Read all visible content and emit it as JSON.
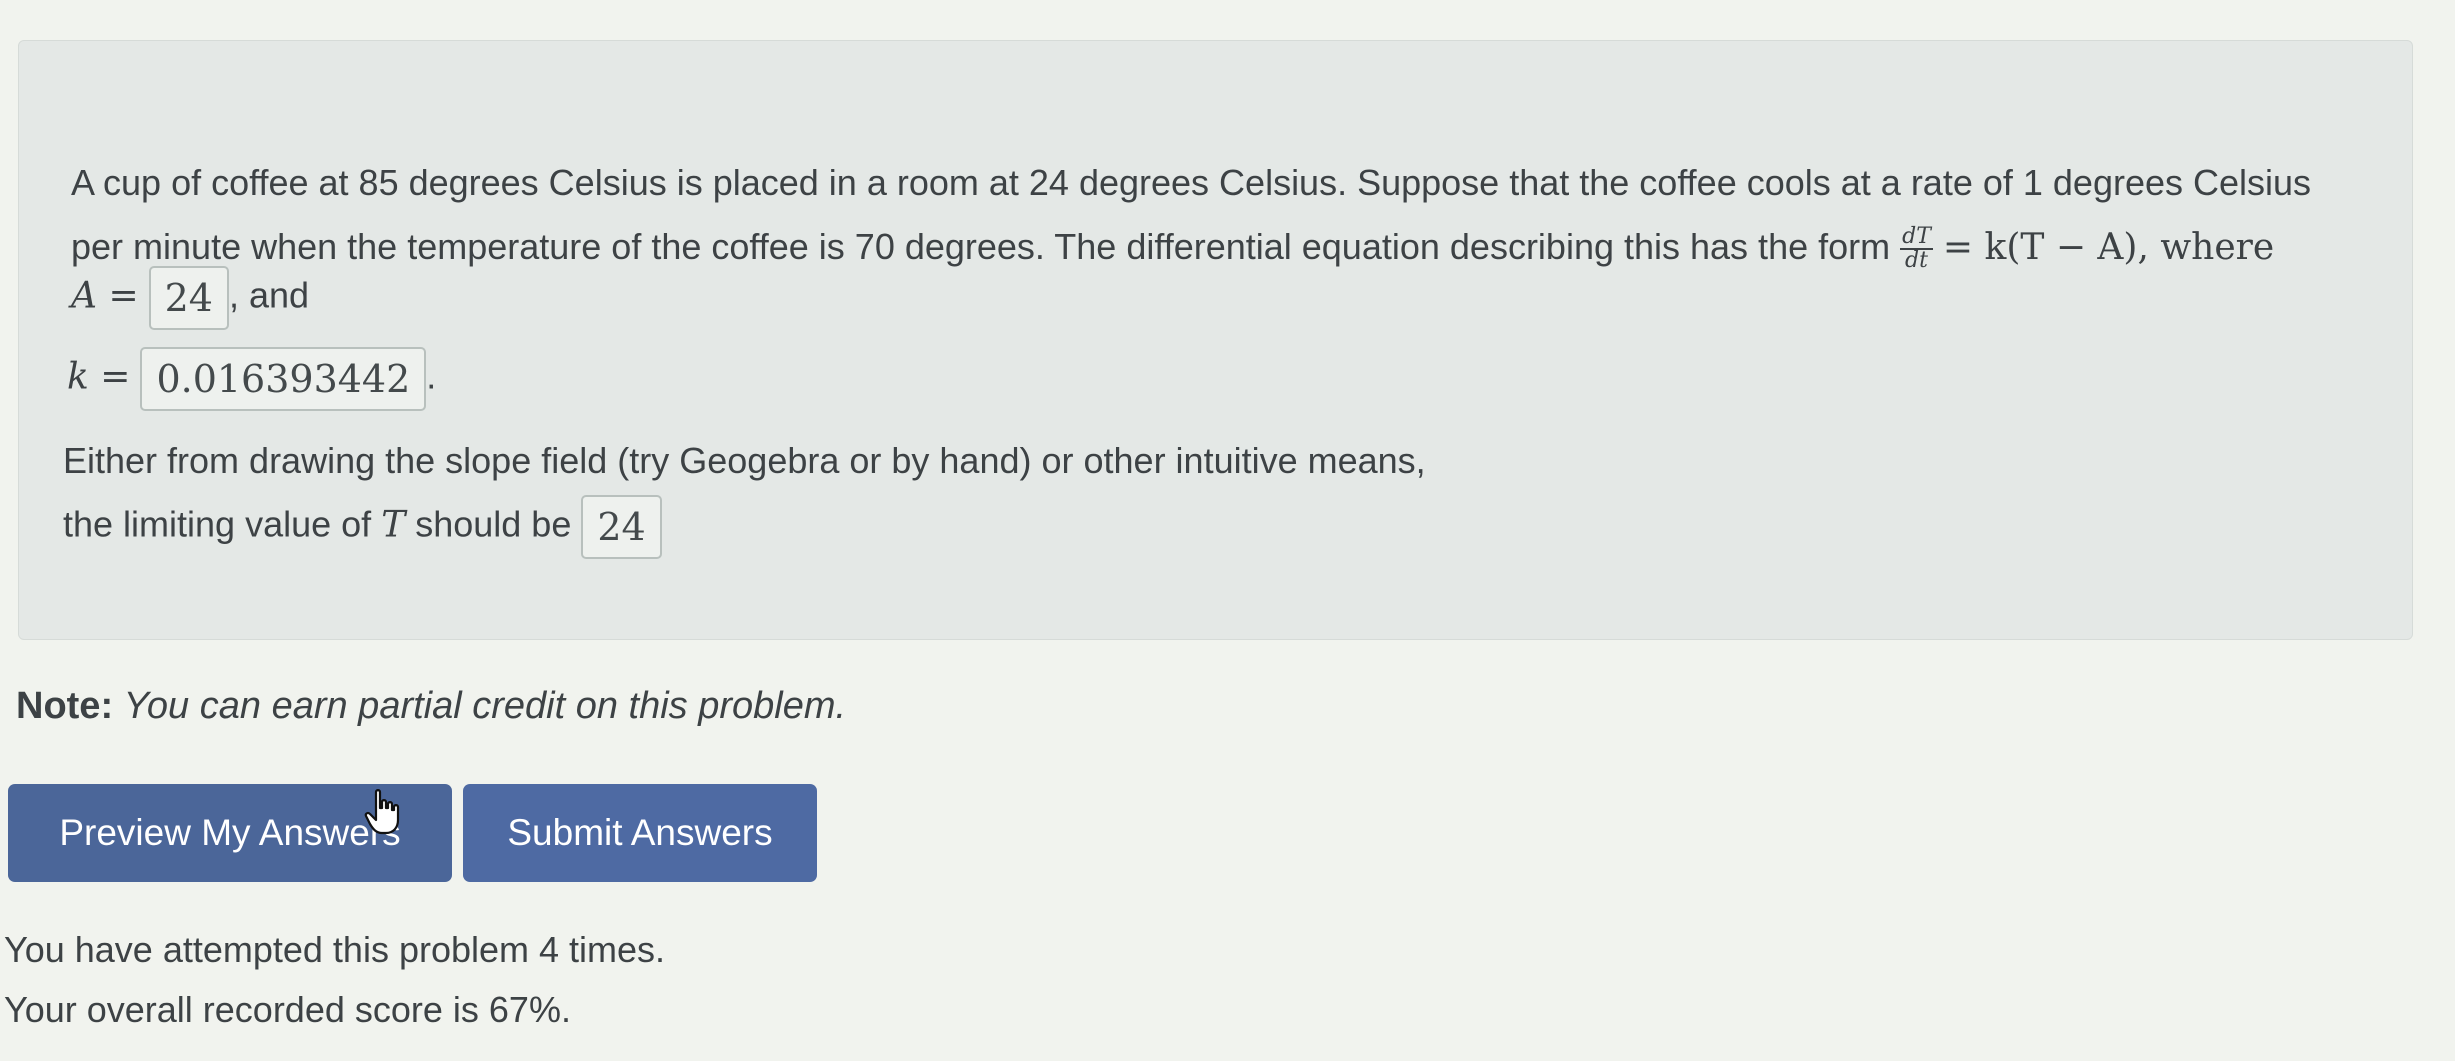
{
  "problem": {
    "line1": "A cup of coffee at 85 degrees Celsius is placed in a room at 24 degrees Celsius. Suppose that the coffee cools at a rate of 1 degrees Celsius",
    "line2": "per minute when the temperature of the coffee is 70 degrees. The differential equation describing this has the form",
    "frac_num": "dT",
    "frac_den": "dt",
    "eq_rhs": "= k(T − A), where",
    "A_label": "A =",
    "A_value": "24",
    "A_suffix": ", and",
    "k_label": "k =",
    "k_value": "0.016393442",
    "k_suffix": ".",
    "limit_line1": "Either from drawing the slope field (try Geogebra or by hand) or other intuitive means,",
    "limit_line2_prefix": "the limiting value of",
    "limit_var": "T",
    "limit_line2_suffix": "should be",
    "limit_value": "24"
  },
  "note": {
    "label": "Note:",
    "text": "You can earn partial credit on this problem."
  },
  "buttons": {
    "preview": "Preview My Answers",
    "submit": "Submit Answers"
  },
  "status": {
    "attempts": "You have attempted this problem 4 times.",
    "score": "Your overall recorded score is 67%."
  }
}
